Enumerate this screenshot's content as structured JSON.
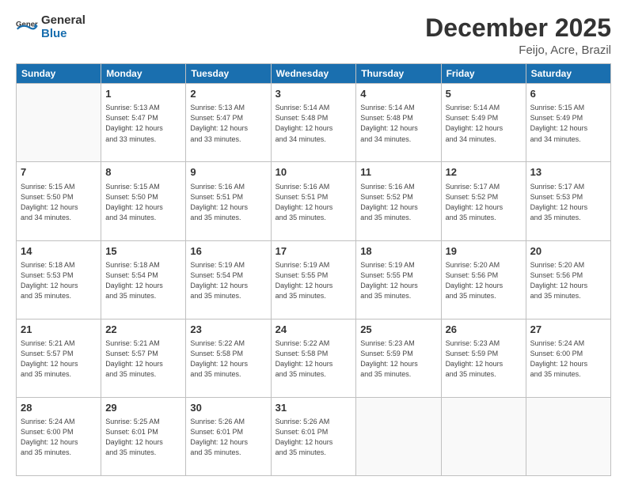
{
  "logo": {
    "text_general": "General",
    "text_blue": "Blue"
  },
  "header": {
    "month": "December 2025",
    "location": "Feijo, Acre, Brazil"
  },
  "weekdays": [
    "Sunday",
    "Monday",
    "Tuesday",
    "Wednesday",
    "Thursday",
    "Friday",
    "Saturday"
  ],
  "weeks": [
    [
      {
        "day": "",
        "info": ""
      },
      {
        "day": "1",
        "info": "Sunrise: 5:13 AM\nSunset: 5:47 PM\nDaylight: 12 hours\nand 33 minutes."
      },
      {
        "day": "2",
        "info": "Sunrise: 5:13 AM\nSunset: 5:47 PM\nDaylight: 12 hours\nand 33 minutes."
      },
      {
        "day": "3",
        "info": "Sunrise: 5:14 AM\nSunset: 5:48 PM\nDaylight: 12 hours\nand 34 minutes."
      },
      {
        "day": "4",
        "info": "Sunrise: 5:14 AM\nSunset: 5:48 PM\nDaylight: 12 hours\nand 34 minutes."
      },
      {
        "day": "5",
        "info": "Sunrise: 5:14 AM\nSunset: 5:49 PM\nDaylight: 12 hours\nand 34 minutes."
      },
      {
        "day": "6",
        "info": "Sunrise: 5:15 AM\nSunset: 5:49 PM\nDaylight: 12 hours\nand 34 minutes."
      }
    ],
    [
      {
        "day": "7",
        "info": "Sunrise: 5:15 AM\nSunset: 5:50 PM\nDaylight: 12 hours\nand 34 minutes."
      },
      {
        "day": "8",
        "info": "Sunrise: 5:15 AM\nSunset: 5:50 PM\nDaylight: 12 hours\nand 34 minutes."
      },
      {
        "day": "9",
        "info": "Sunrise: 5:16 AM\nSunset: 5:51 PM\nDaylight: 12 hours\nand 35 minutes."
      },
      {
        "day": "10",
        "info": "Sunrise: 5:16 AM\nSunset: 5:51 PM\nDaylight: 12 hours\nand 35 minutes."
      },
      {
        "day": "11",
        "info": "Sunrise: 5:16 AM\nSunset: 5:52 PM\nDaylight: 12 hours\nand 35 minutes."
      },
      {
        "day": "12",
        "info": "Sunrise: 5:17 AM\nSunset: 5:52 PM\nDaylight: 12 hours\nand 35 minutes."
      },
      {
        "day": "13",
        "info": "Sunrise: 5:17 AM\nSunset: 5:53 PM\nDaylight: 12 hours\nand 35 minutes."
      }
    ],
    [
      {
        "day": "14",
        "info": "Sunrise: 5:18 AM\nSunset: 5:53 PM\nDaylight: 12 hours\nand 35 minutes."
      },
      {
        "day": "15",
        "info": "Sunrise: 5:18 AM\nSunset: 5:54 PM\nDaylight: 12 hours\nand 35 minutes."
      },
      {
        "day": "16",
        "info": "Sunrise: 5:19 AM\nSunset: 5:54 PM\nDaylight: 12 hours\nand 35 minutes."
      },
      {
        "day": "17",
        "info": "Sunrise: 5:19 AM\nSunset: 5:55 PM\nDaylight: 12 hours\nand 35 minutes."
      },
      {
        "day": "18",
        "info": "Sunrise: 5:19 AM\nSunset: 5:55 PM\nDaylight: 12 hours\nand 35 minutes."
      },
      {
        "day": "19",
        "info": "Sunrise: 5:20 AM\nSunset: 5:56 PM\nDaylight: 12 hours\nand 35 minutes."
      },
      {
        "day": "20",
        "info": "Sunrise: 5:20 AM\nSunset: 5:56 PM\nDaylight: 12 hours\nand 35 minutes."
      }
    ],
    [
      {
        "day": "21",
        "info": "Sunrise: 5:21 AM\nSunset: 5:57 PM\nDaylight: 12 hours\nand 35 minutes."
      },
      {
        "day": "22",
        "info": "Sunrise: 5:21 AM\nSunset: 5:57 PM\nDaylight: 12 hours\nand 35 minutes."
      },
      {
        "day": "23",
        "info": "Sunrise: 5:22 AM\nSunset: 5:58 PM\nDaylight: 12 hours\nand 35 minutes."
      },
      {
        "day": "24",
        "info": "Sunrise: 5:22 AM\nSunset: 5:58 PM\nDaylight: 12 hours\nand 35 minutes."
      },
      {
        "day": "25",
        "info": "Sunrise: 5:23 AM\nSunset: 5:59 PM\nDaylight: 12 hours\nand 35 minutes."
      },
      {
        "day": "26",
        "info": "Sunrise: 5:23 AM\nSunset: 5:59 PM\nDaylight: 12 hours\nand 35 minutes."
      },
      {
        "day": "27",
        "info": "Sunrise: 5:24 AM\nSunset: 6:00 PM\nDaylight: 12 hours\nand 35 minutes."
      }
    ],
    [
      {
        "day": "28",
        "info": "Sunrise: 5:24 AM\nSunset: 6:00 PM\nDaylight: 12 hours\nand 35 minutes."
      },
      {
        "day": "29",
        "info": "Sunrise: 5:25 AM\nSunset: 6:01 PM\nDaylight: 12 hours\nand 35 minutes."
      },
      {
        "day": "30",
        "info": "Sunrise: 5:26 AM\nSunset: 6:01 PM\nDaylight: 12 hours\nand 35 minutes."
      },
      {
        "day": "31",
        "info": "Sunrise: 5:26 AM\nSunset: 6:01 PM\nDaylight: 12 hours\nand 35 minutes."
      },
      {
        "day": "",
        "info": ""
      },
      {
        "day": "",
        "info": ""
      },
      {
        "day": "",
        "info": ""
      }
    ]
  ]
}
